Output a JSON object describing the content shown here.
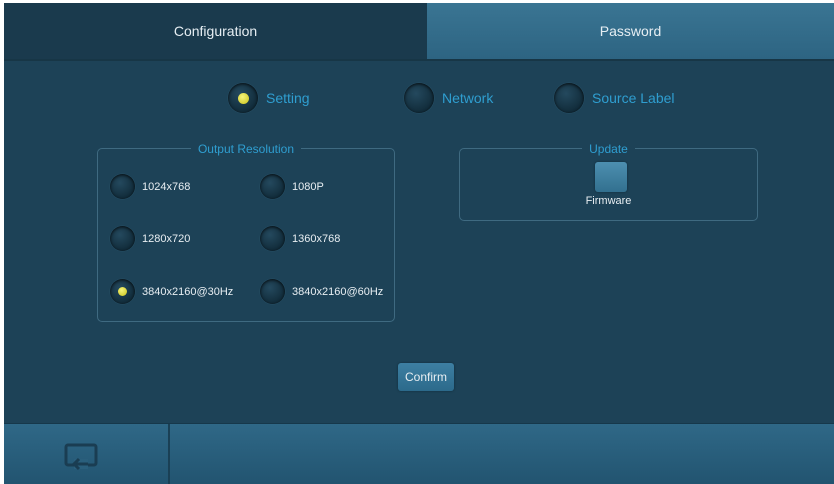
{
  "tabs": [
    {
      "label": "Configuration",
      "active": true
    },
    {
      "label": "Password",
      "active": false
    }
  ],
  "top_options": [
    {
      "label": "Setting",
      "selected": true
    },
    {
      "label": "Network",
      "selected": false
    },
    {
      "label": "Source Label",
      "selected": false
    }
  ],
  "output_resolution": {
    "title": "Output Resolution",
    "options": [
      {
        "label": "1024x768",
        "selected": false
      },
      {
        "label": "1080P",
        "selected": false
      },
      {
        "label": "1280x720",
        "selected": false
      },
      {
        "label": "1360x768",
        "selected": false
      },
      {
        "label": "3840x2160@30Hz",
        "selected": true
      },
      {
        "label": "3840x2160@60Hz",
        "selected": false
      }
    ]
  },
  "update": {
    "title": "Update",
    "firmware_label": "Firmware"
  },
  "confirm_label": "Confirm",
  "bottom_bar": {
    "back_icon": "return-icon"
  },
  "colors": {
    "background": "#1d4257",
    "accent_text": "#2f9ed0",
    "selected_dot": "#e8e44a",
    "active_tab": "#1a3a4d",
    "inactive_tab": "#3a7593"
  }
}
